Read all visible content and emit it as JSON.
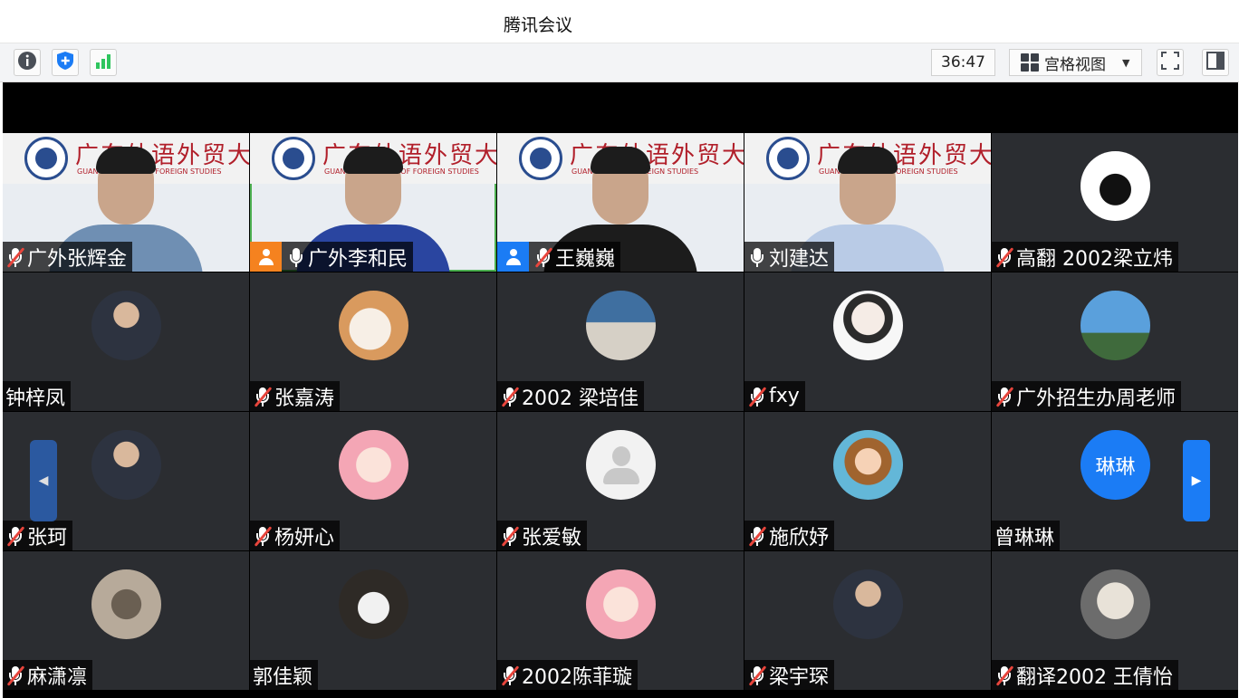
{
  "window": {
    "title": "腾讯会议"
  },
  "toolbar": {
    "timer": "36:47",
    "view_label": "宫格视图",
    "icons": [
      "info-icon",
      "shield-icon",
      "signal-icon",
      "fullscreen-icon",
      "sidebar-toggle-icon",
      "chevron-down-icon"
    ]
  },
  "colors": {
    "accent": "#1b7cf5",
    "host": "#f5821f",
    "muted": "#e8453c",
    "tile_bg": "#2b2d31",
    "active_border": "#4caf50"
  },
  "participants": [
    {
      "name": "广外张辉金",
      "mic": "muted",
      "video": true,
      "banner": "广东外语外贸大学",
      "banner_en": "GUANGDONG U... OF FOREIGN STUDIES"
    },
    {
      "name": "广外李和民",
      "mic": "on",
      "role": "host",
      "video": true,
      "active": true,
      "banner": "广东外语外贸大学",
      "banner_en": "GUANGDONG ...SITY OF FOREIGN STUDIES"
    },
    {
      "name": "王巍巍",
      "mic": "muted",
      "role": "cohost",
      "video": true,
      "banner": "广东外语外贸大学",
      "banner_en": "GUANGDONG ... FOREIGN STUDIES"
    },
    {
      "name": "刘建达",
      "mic": "on",
      "video": true,
      "banner": "广东外语外贸大学",
      "banner_en": "GUANGDONG ... OF FOREIGN STUDIES"
    },
    {
      "name": "高翻 2002梁立炜",
      "mic": "muted",
      "avatar": "penguin-avatar"
    },
    {
      "name": "钟梓凤",
      "mic": "none",
      "avatar": "person-avatar"
    },
    {
      "name": "张嘉涛",
      "mic": "muted",
      "avatar": "cat-avatar"
    },
    {
      "name": "2002 梁培佳",
      "mic": "muted",
      "avatar": "street-avatar"
    },
    {
      "name": "fxy",
      "mic": "muted",
      "avatar": "anime-avatar"
    },
    {
      "name": "广外招生办周老师",
      "mic": "muted",
      "avatar": "palm-tree-avatar"
    },
    {
      "name": "张珂",
      "mic": "muted",
      "avatar": "person-avatar"
    },
    {
      "name": "杨妍心",
      "mic": "muted",
      "avatar": "cartoon-avatar"
    },
    {
      "name": "张爱敏",
      "mic": "muted",
      "avatar": "default-avatar"
    },
    {
      "name": "施欣妤",
      "mic": "muted",
      "avatar": "cartoon-girl-avatar"
    },
    {
      "name": "曾琳琳",
      "mic": "none",
      "avatar_text": "琳琳"
    },
    {
      "name": "麻潇凛",
      "mic": "muted",
      "avatar": "cat-dark-avatar"
    },
    {
      "name": "郭佳颖",
      "mic": "none",
      "avatar": "dog-avatar"
    },
    {
      "name": "2002陈菲璇",
      "mic": "muted",
      "avatar": "cartoon-avatar"
    },
    {
      "name": "梁宇琛",
      "mic": "muted",
      "avatar": "person-avatar"
    },
    {
      "name": "翻译2002 王倩怡",
      "mic": "muted",
      "avatar": "sketch-avatar"
    }
  ]
}
